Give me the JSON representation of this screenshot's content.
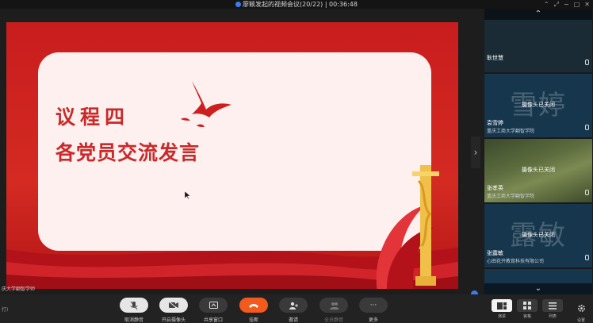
{
  "window": {
    "title": "廖颖发起的视频会议(20/22) | 00:36:48",
    "controls": [
      "⌃",
      "⤢",
      "−",
      "□",
      "✕"
    ]
  },
  "slide": {
    "agenda": "议程四",
    "topic": "各党员交流发言"
  },
  "stage": {
    "caption": "庆大学翻智学师",
    "expand_handle": "›"
  },
  "participants": [
    {
      "name": "耿世慧",
      "org": "",
      "avatar_text": "",
      "status": "",
      "style": "blue"
    },
    {
      "name": "袁雪婷",
      "org": "重庆工商大学翻智学院",
      "avatar_text": "雪婷",
      "status": "摄像头已关闭",
      "style": "blue"
    },
    {
      "name": "张孝英",
      "org": "重庆工商大学翻智学院",
      "avatar_text": "",
      "status": "摄像头已关闭",
      "style": "green"
    },
    {
      "name": "张露敏",
      "org": "心田花开教育科技有限公司",
      "avatar_text": "露敏",
      "status": "摄像头已关闭",
      "style": "blue"
    }
  ],
  "toolbar": {
    "left_text": "打)",
    "tools": [
      {
        "label": "取消静音",
        "icon": "mic-muted-icon"
      },
      {
        "label": "开启摄像头",
        "icon": "camera-off-icon"
      },
      {
        "label": "共享窗口",
        "icon": "share-window-icon"
      },
      {
        "label": "挂断",
        "icon": "hangup-icon"
      },
      {
        "label": "邀请",
        "icon": "invite-icon"
      },
      {
        "label": "全员静音",
        "icon": "mute-all-icon"
      },
      {
        "label": "更多",
        "icon": "more-icon"
      }
    ],
    "views": [
      {
        "label": "演讲",
        "icon": "speaker-view-icon"
      },
      {
        "label": "宫格",
        "icon": "grid-view-icon"
      },
      {
        "label": "列表",
        "icon": "list-view-icon"
      }
    ],
    "settings_label": "设置",
    "more_glyph": "···"
  },
  "colors": {
    "slide_red": "#c81d1d",
    "hangup": "#f25a1e",
    "accent_blue": "#3a7cf0"
  }
}
